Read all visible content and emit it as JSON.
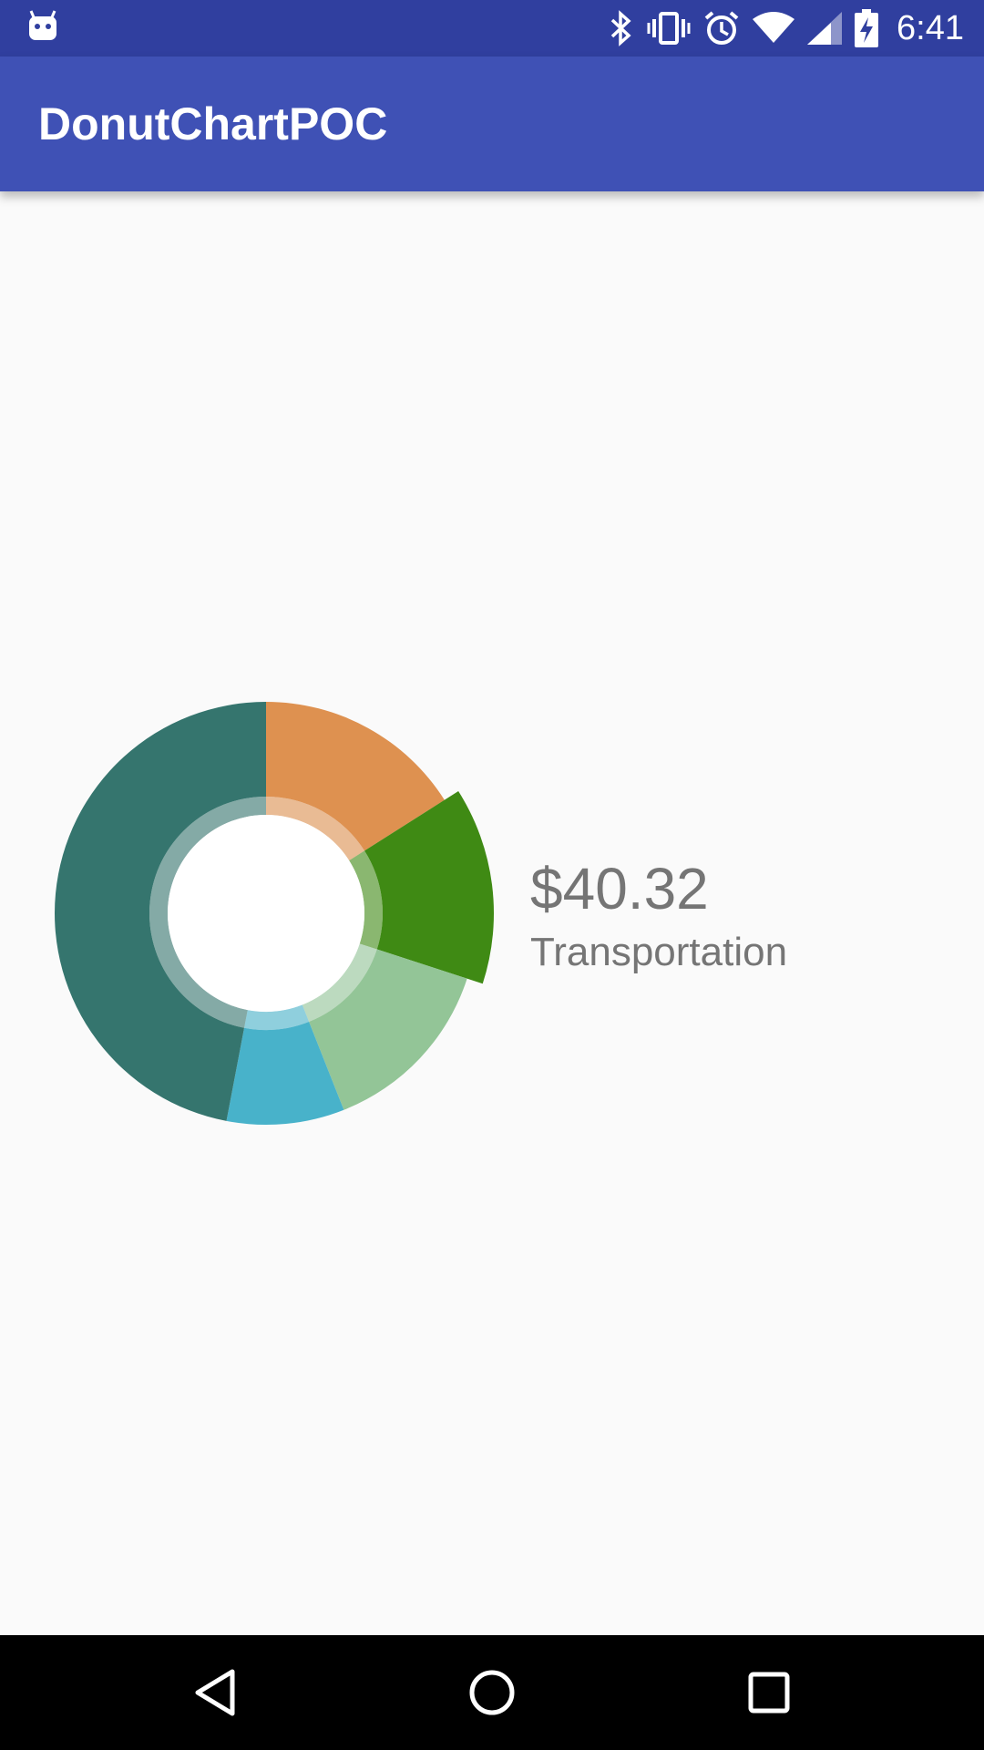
{
  "status_bar": {
    "time": "6:41",
    "icons": [
      "android-notification-icon",
      "bluetooth-icon",
      "vibrate-icon",
      "alarm-icon",
      "wifi-icon",
      "cell-signal-icon",
      "battery-charging-icon"
    ],
    "background": "#303f9f"
  },
  "app_bar": {
    "title": "DonutChartPOC",
    "background": "#3f51b5"
  },
  "detail": {
    "amount": "$40.32",
    "category": "Transportation"
  },
  "chart_data": {
    "type": "pie",
    "variant": "donut",
    "selected": 1,
    "segments": [
      {
        "value": 16,
        "color": "#de9150"
      },
      {
        "value": 14,
        "color": "#3f8a14"
      },
      {
        "value": 14,
        "color": "#93c597"
      },
      {
        "value": 9,
        "color": "#48b2ca"
      },
      {
        "value": 47,
        "color": "#35756e"
      }
    ]
  },
  "nav_bar": {
    "buttons": [
      "back-icon",
      "home-icon",
      "recents-icon"
    ]
  }
}
